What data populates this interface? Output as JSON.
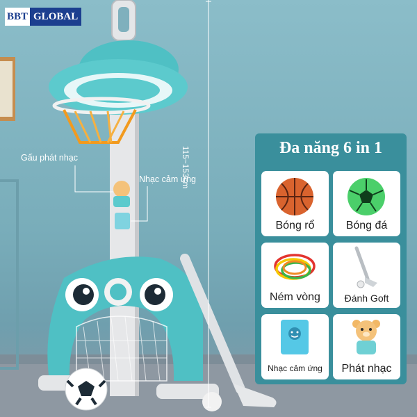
{
  "brand": {
    "part1": "BBT",
    "part2": "GLOBAL"
  },
  "callouts": {
    "bear_music": "Gấu phát nhạc",
    "touch_music": "Nhạc cảm ứng",
    "height_range": "115~153cm"
  },
  "panel": {
    "title": "Đa năng 6 in 1",
    "items": [
      {
        "label": "Bóng rổ",
        "icon": "basketball-icon"
      },
      {
        "label": "Bóng đá",
        "icon": "soccer-ball-icon"
      },
      {
        "label": "Ném vòng",
        "icon": "rings-icon"
      },
      {
        "label": "Đánh Goft",
        "icon": "golf-club-icon"
      },
      {
        "label": "Nhạc cảm ứng",
        "icon": "music-box-icon"
      },
      {
        "label": "Phát nhạc",
        "icon": "bear-icon"
      }
    ]
  },
  "colors": {
    "panel_bg": "#3a8f9c",
    "product_teal": "#4fc0c4",
    "brand_blue": "#1c3f8f"
  }
}
